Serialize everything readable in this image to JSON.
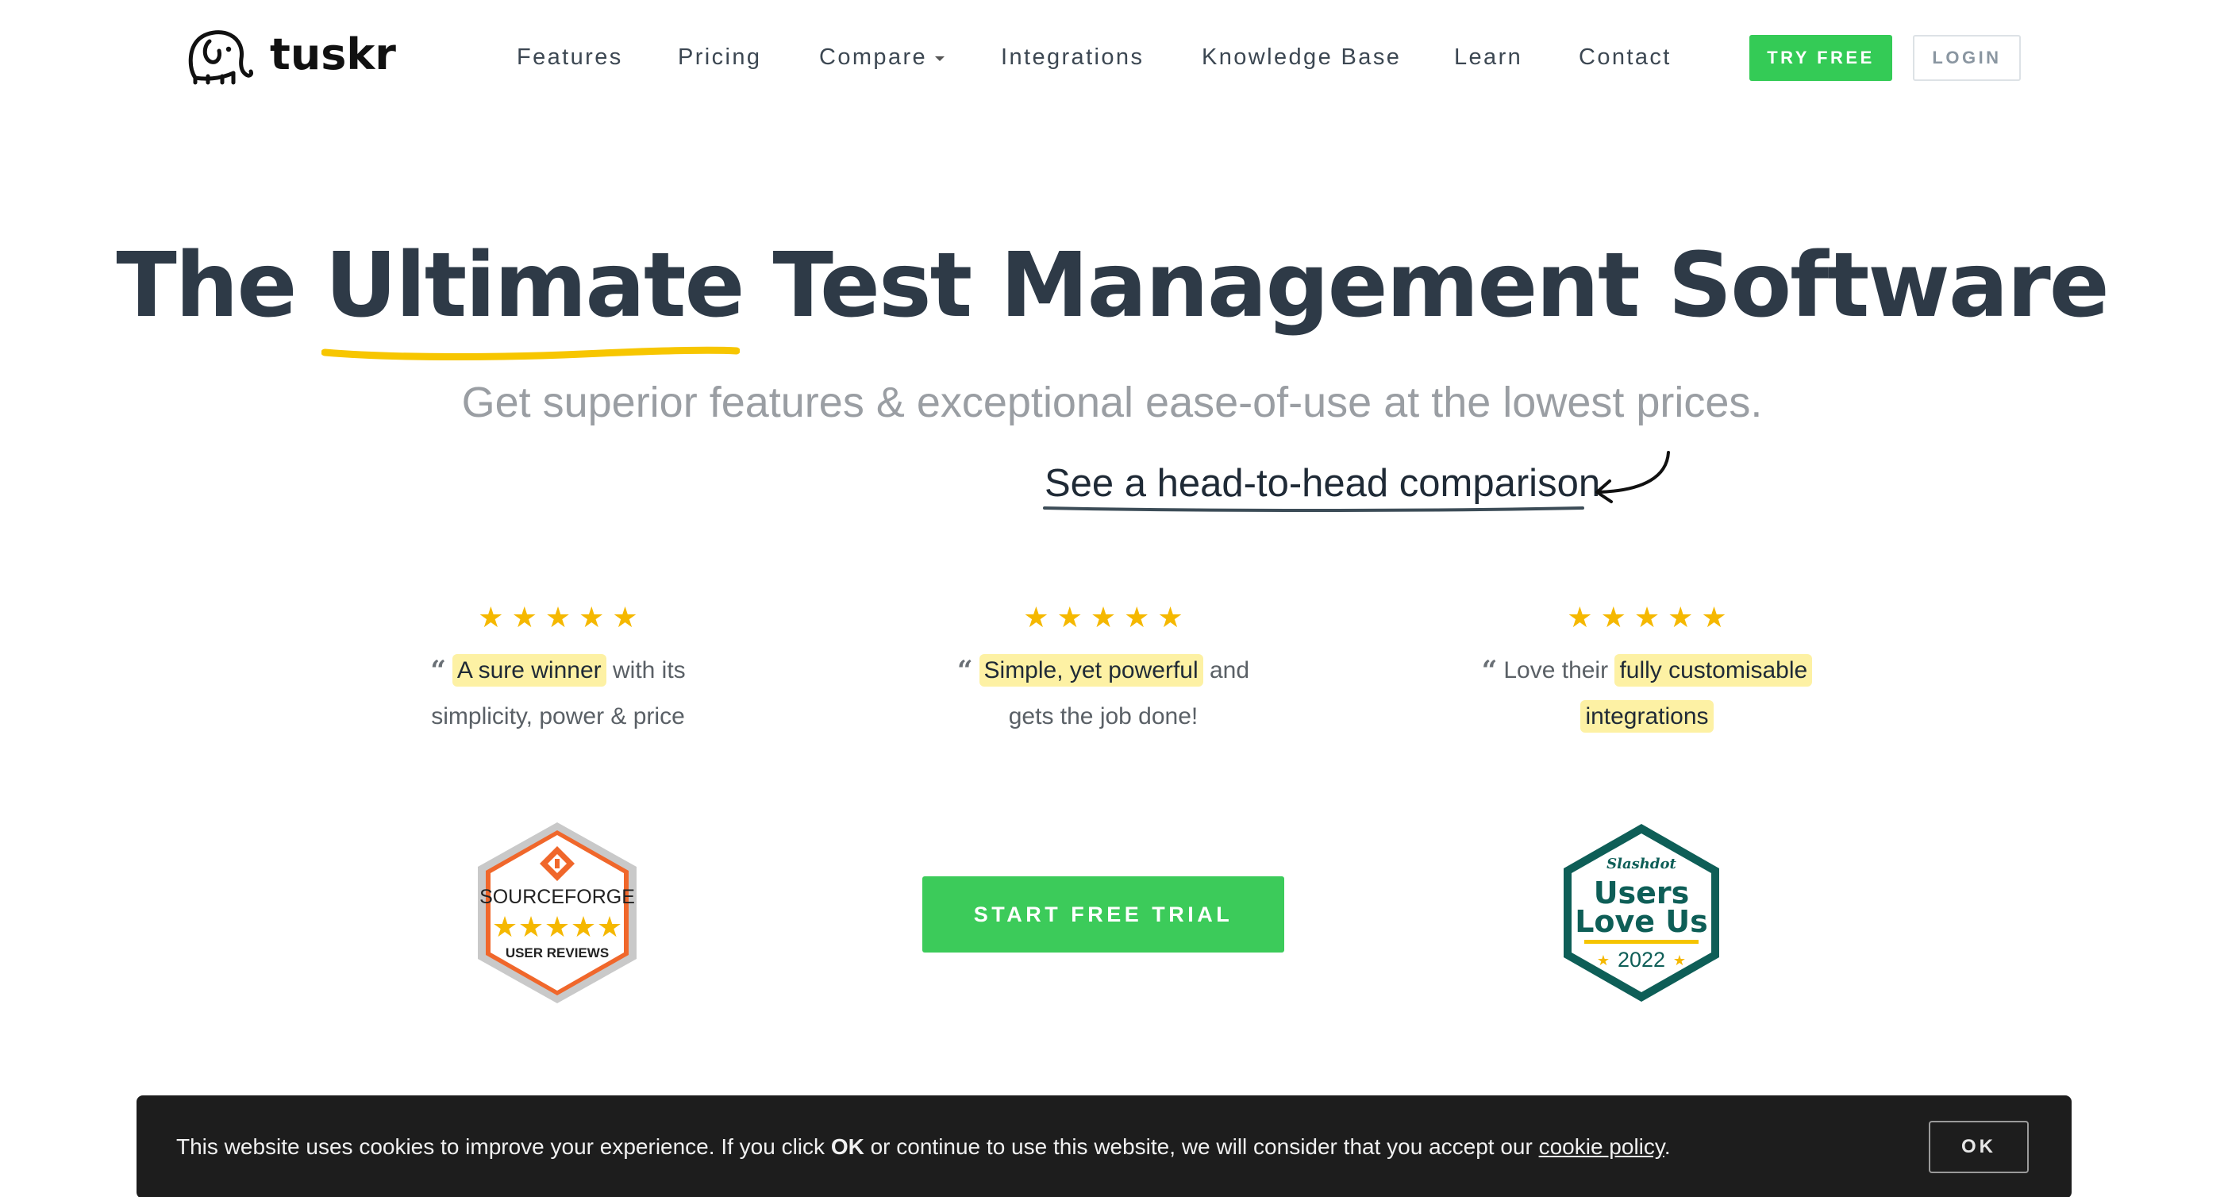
{
  "brand": {
    "name": "tuskr",
    "logo_icon": "elephant-icon"
  },
  "nav": {
    "items": [
      {
        "label": "Features"
      },
      {
        "label": "Pricing"
      },
      {
        "label": "Compare",
        "has_dropdown": true
      },
      {
        "label": "Integrations"
      },
      {
        "label": "Knowledge Base"
      },
      {
        "label": "Learn"
      },
      {
        "label": "Contact"
      }
    ],
    "try_free_label": "TRY FREE",
    "login_label": "LOGIN"
  },
  "hero": {
    "title_prefix": "The",
    "title_highlight": "Ultimate",
    "title_suffix": "Test Management Software",
    "subtitle": "Get superior features & exceptional ease-of-use at the lowest prices.",
    "compare_link": "See a head-to-head comparison"
  },
  "testimonials": [
    {
      "rating": 5,
      "quote_mark": "“",
      "highlight": "A sure winner",
      "before": "",
      "after_line1": "with its",
      "line2_text": "simplicity, power & price"
    },
    {
      "rating": 5,
      "quote_mark": "“",
      "highlight": "Simple, yet powerful",
      "before": "",
      "after_line1": "and",
      "line2_text": "gets the job done!"
    },
    {
      "rating": 5,
      "quote_mark": "“",
      "before": "Love their",
      "highlight": "fully customisable",
      "line2_highlight": "integrations"
    }
  ],
  "badges": {
    "sourceforge": {
      "title": "SOURCEFORGE",
      "subtitle": "USER REVIEWS",
      "rating": 5
    },
    "slashdot": {
      "brand": "Slashdot",
      "line1": "Users",
      "line2": "Love Us",
      "year": "2022"
    }
  },
  "cta_label": "START FREE TRIAL",
  "cookie": {
    "text_before": "This website uses cookies to improve your experience. If you click",
    "ok_inline": "OK",
    "text_middle": "or continue to use this website, we will consider that you accept our",
    "link_text": "cookie policy",
    "text_end": ".",
    "button_label": "OK"
  },
  "colors": {
    "primary_green": "#34cb56",
    "star_yellow": "#f5b800",
    "highlight_yellow": "#fdf1a4",
    "heading": "#2e3a47",
    "sourceforge_orange": "#f0672b",
    "slashdot_teal": "#0e5e57"
  }
}
